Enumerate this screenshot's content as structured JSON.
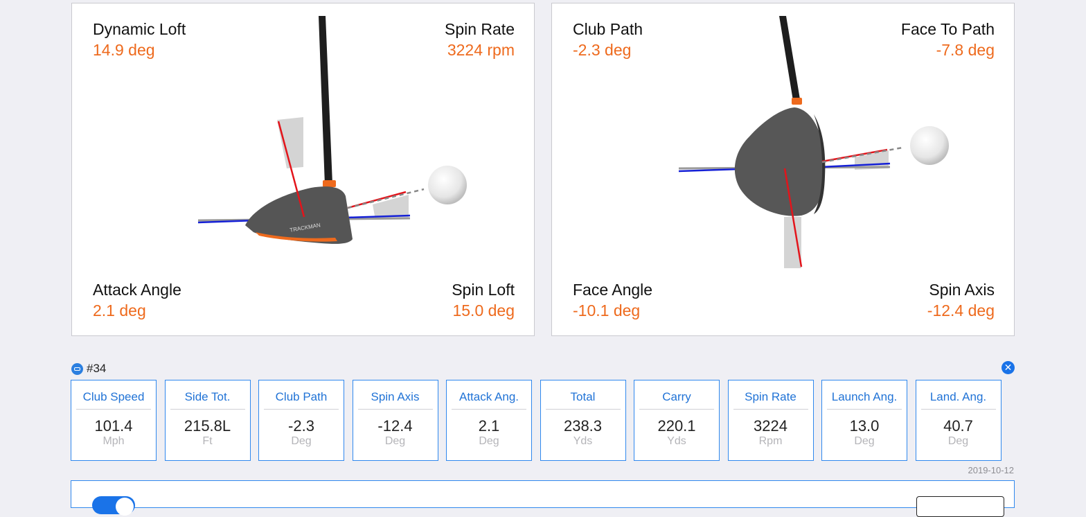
{
  "left_panel": {
    "top_left": {
      "label": "Dynamic Loft",
      "value": "14.9 deg"
    },
    "top_right": {
      "label": "Spin Rate",
      "value": "3224 rpm"
    },
    "bottom_left": {
      "label": "Attack Angle",
      "value": "2.1 deg"
    },
    "bottom_right": {
      "label": "Spin Loft",
      "value": "15.0 deg"
    },
    "club_brand": "TRACKMAN"
  },
  "right_panel": {
    "top_left": {
      "label": "Club Path",
      "value": "-2.3 deg"
    },
    "top_right": {
      "label": "Face To Path",
      "value": "-7.8 deg"
    },
    "bottom_left": {
      "label": "Face Angle",
      "value": "-10.1 deg"
    },
    "bottom_right": {
      "label": "Spin Axis",
      "value": "-12.4 deg"
    }
  },
  "shot": {
    "number": "#34",
    "icon": "shot-type-icon",
    "close_icon": "close-icon",
    "close_glyph": "✕",
    "date": "2019-10-12"
  },
  "tiles": [
    {
      "label": "Club Speed",
      "value": "101.4",
      "unit": "Mph"
    },
    {
      "label": "Side Tot.",
      "value": "215.8L",
      "unit": "Ft"
    },
    {
      "label": "Club Path",
      "value": "-2.3",
      "unit": "Deg"
    },
    {
      "label": "Spin Axis",
      "value": "-12.4",
      "unit": "Deg"
    },
    {
      "label": "Attack Ang.",
      "value": "2.1",
      "unit": "Deg"
    },
    {
      "label": "Total",
      "value": "238.3",
      "unit": "Yds"
    },
    {
      "label": "Carry",
      "value": "220.1",
      "unit": "Yds"
    },
    {
      "label": "Spin Rate",
      "value": "3224",
      "unit": "Rpm"
    },
    {
      "label": "Launch Ang.",
      "value": "13.0",
      "unit": "Deg"
    },
    {
      "label": "Land. Ang.",
      "value": "40.7",
      "unit": "Deg"
    }
  ],
  "colors": {
    "accent_blue": "#1a73e8",
    "value_orange": "#ee6a1d",
    "face_line_red": "#e3141b",
    "path_line_blue": "#1520d6",
    "club_head": "#555555"
  }
}
